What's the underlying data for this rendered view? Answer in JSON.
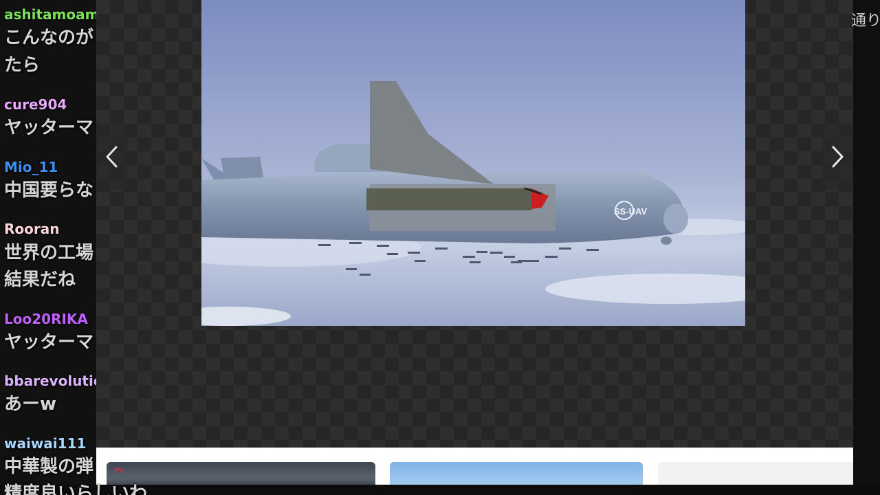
{
  "viewer": {
    "photo": {
      "aircraft_marking": "SS-UAV",
      "colors": {
        "sky_top": "#7f8fc0",
        "sky_bottom": "#c7d1e6",
        "fuselage": "#8b9bb4",
        "nose_red": "#cc2020"
      }
    },
    "nav": {
      "prev_icon": "chevron-left-icon",
      "next_icon": "chevron-right-icon"
    }
  },
  "right_edge_text": "通りで",
  "chat": {
    "messages": [
      {
        "user": "ashitamoamo",
        "user_color": "#7be05a",
        "lines": [
          "こんなのが",
          "たら"
        ]
      },
      {
        "user": "cure904",
        "user_color": "#e7a7ff",
        "lines": [
          "ヤッターマ"
        ]
      },
      {
        "user": "Mio_11",
        "user_color": "#3f8ff0",
        "lines": [
          "中国要らな"
        ]
      },
      {
        "user": "Rooran",
        "user_color": "#ffd6dc",
        "lines": [
          "世界の工場",
          "結果だね"
        ]
      },
      {
        "user": "Loo20RIKA",
        "user_color": "#c061ff",
        "lines": [
          "ヤッターマ"
        ]
      },
      {
        "user": "bbarevolution",
        "user_color": "#d9b3ff",
        "lines": [
          "あーw"
        ]
      },
      {
        "user": "waiwai111",
        "user_color": "#a9d7ff",
        "lines": [
          "中華製の弾",
          "精度良いらしいわ"
        ]
      }
    ]
  },
  "thumbs": {
    "badge": "TV"
  }
}
